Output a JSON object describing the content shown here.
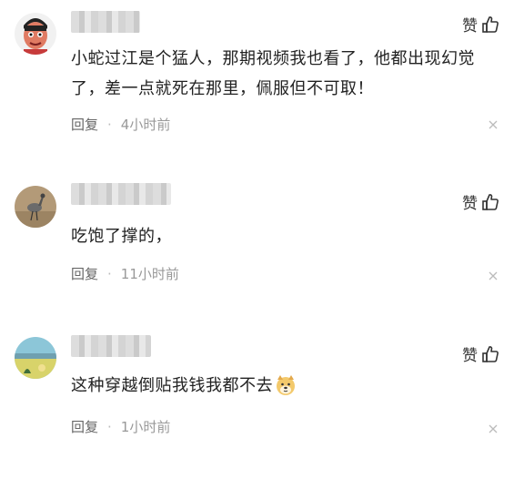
{
  "comments": [
    {
      "like_label": "赞",
      "text": "小蛇过江是个猛人，那期视频我也看了，他都出现幻觉了，差一点就死在那里，佩服但不可取！",
      "reply_label": "回复",
      "separator": "·",
      "time": "4小时前",
      "avatar_icon": "cartoon-face-avatar-icon",
      "close_icon": "close-icon"
    },
    {
      "like_label": "赞",
      "text": "吃饱了撑的，",
      "reply_label": "回复",
      "separator": "·",
      "time": "11小时前",
      "avatar_icon": "bird-photo-avatar-icon",
      "close_icon": "close-icon"
    },
    {
      "like_label": "赞",
      "text": "这种穿越倒贴我钱我都不去",
      "emoji": "doge-emoji",
      "reply_label": "回复",
      "separator": "·",
      "time": "1小时前",
      "avatar_icon": "landscape-photo-avatar-icon",
      "close_icon": "close-icon"
    }
  ],
  "colors": {
    "text": "#222222",
    "meta": "#999999",
    "reply": "#666666"
  }
}
